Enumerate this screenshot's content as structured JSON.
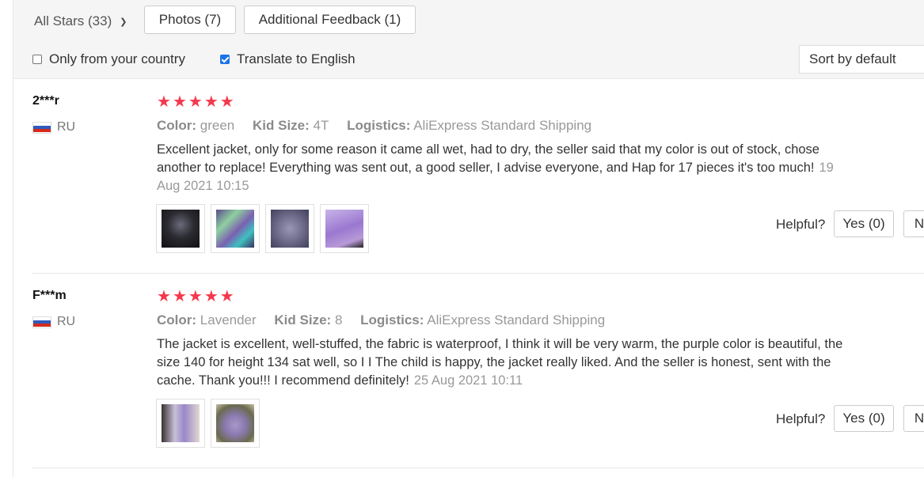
{
  "filters": {
    "stars_select": "All Stars (33)",
    "photos_button": "Photos (7)",
    "feedback_button": "Additional Feedback (1)",
    "only_country_label": "Only from your country",
    "only_country_checked": false,
    "translate_label": "Translate to English",
    "translate_checked": true,
    "sort_select": "Sort by default"
  },
  "labels": {
    "color": "Color:",
    "kid_size": "Kid Size:",
    "logistics": "Logistics:",
    "helpful": "Helpful?",
    "yes": "Yes (0)",
    "no": "N"
  },
  "reviews": [
    {
      "author": "2***r",
      "country": "RU",
      "rating": 5,
      "color": "green",
      "kid_size": "4T",
      "logistics": "AliExpress Standard Shipping",
      "text": "Excellent jacket, only for some reason it came all wet, had to dry, the seller said that my color is out of stock, chose another to replace! Everything was sent out, a good seller, I advise everyone, and Hap for 17 pieces it's too much!",
      "date": "19 Aug 2021 10:15",
      "photos": [
        "photo-1",
        "photo-2",
        "photo-3",
        "photo-4"
      ]
    },
    {
      "author": "F***m",
      "country": "RU",
      "rating": 5,
      "color": "Lavender",
      "kid_size": "8",
      "logistics": "AliExpress Standard Shipping",
      "text": "The jacket is excellent, well-stuffed, the fabric is waterproof, I think it will be very warm, the purple color is beautiful, the size 140 for height 134 sat well, so I I The child is happy, the jacket really liked. And the seller is honest, sent with the cache. Thank you!!! I recommend definitely!",
      "date": "25 Aug 2021 10:11",
      "photos": [
        "photo-1",
        "photo-2"
      ]
    }
  ],
  "colors": {
    "star": "#f5384c",
    "checkbox_accent": "#1a73e8",
    "flag_white": "#ffffff",
    "flag_blue": "#2f5bbd",
    "flag_red": "#d52b1e"
  },
  "icons": {
    "star": "star-icon",
    "dropdown": "chevron-down-icon",
    "flag": "russia-flag-icon"
  }
}
